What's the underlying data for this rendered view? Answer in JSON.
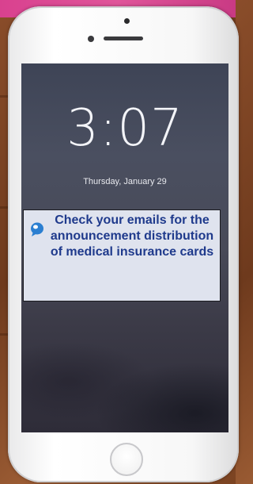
{
  "lock_screen": {
    "time": "3:07",
    "date": "Thursday, January 29"
  },
  "notification": {
    "message": "Check your emails for the announcement distribution of medical insurance cards",
    "icon": "chat-bubble-icon",
    "text_color": "#1f3a8c",
    "background_color": "#dfe3ee"
  }
}
